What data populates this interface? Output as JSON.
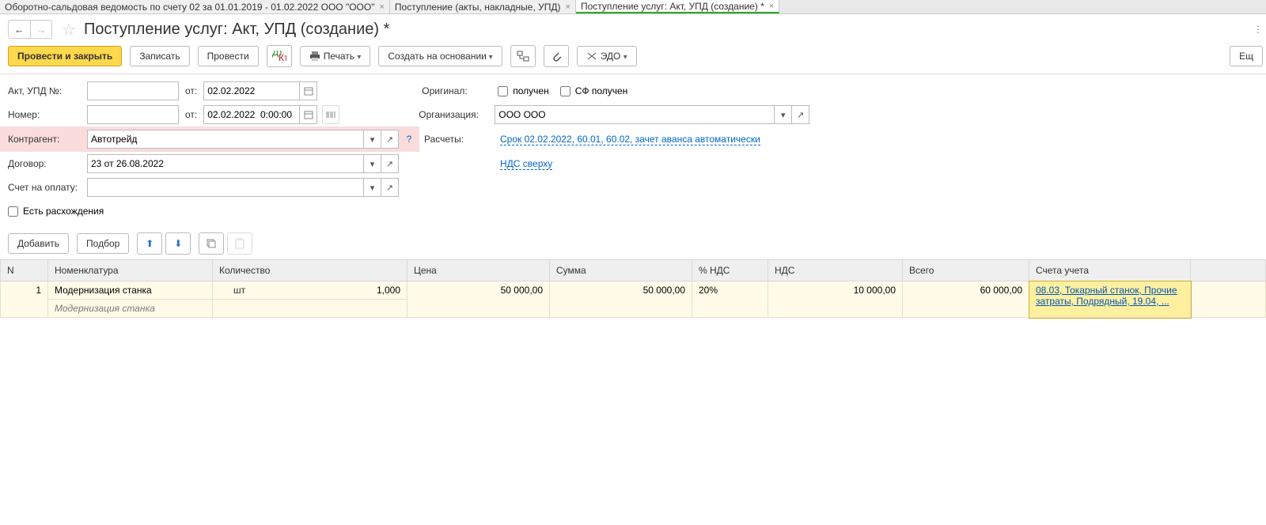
{
  "tabs": [
    {
      "label": "Оборотно-сальдовая ведомость по счету 02 за 01.01.2019 - 01.02.2022 ООО \"ООО\"",
      "active": false
    },
    {
      "label": "Поступление (акты, накладные, УПД)",
      "active": false
    },
    {
      "label": "Поступление услуг: Акт, УПД (создание) *",
      "active": true
    }
  ],
  "page_title": "Поступление услуг: Акт, УПД (создание) *",
  "toolbar": {
    "post_close": "Провести и закрыть",
    "write": "Записать",
    "post": "Провести",
    "print": "Печать",
    "create_based": "Создать на основании",
    "edo": "ЭДО",
    "more": "Ещ"
  },
  "form": {
    "act_no_label": "Акт, УПД №:",
    "act_no_value": "",
    "from_label": "от:",
    "act_date": "02.02.2022",
    "number_label": "Номер:",
    "number_value": "",
    "number_date": "02.02.2022  0:00:00",
    "original_label": "Оригинал:",
    "received_label": "получен",
    "sf_received_label": "СФ получен",
    "org_label": "Организация:",
    "org_value": "ООО ООО",
    "kontr_label": "Контрагент:",
    "kontr_value": "Автотрейд",
    "raschet_label": "Расчеты:",
    "raschet_link": "Срок 02.02.2022, 60.01, 60.02, зачет аванса автоматически",
    "dogovor_label": "Договор:",
    "dogovor_value": "23 от 26.08.2022",
    "nds_link": "НДС сверху",
    "schet_label": "Счет на оплату:",
    "schet_value": "",
    "divergence_label": "Есть расхождения"
  },
  "table_toolbar": {
    "add": "Добавить",
    "select_btn": "Подбор"
  },
  "table": {
    "headers": {
      "n": "N",
      "nom": "Номенклатура",
      "qty": "Количество",
      "price": "Цена",
      "sum": "Сумма",
      "vat_pct": "% НДС",
      "vat": "НДС",
      "total": "Всего",
      "accounts": "Счета учета"
    },
    "rows": [
      {
        "n": "1",
        "nom": "Модернизация станка",
        "nom_sub": "Модернизация станка",
        "qty": "1,000",
        "unit": "шт",
        "price": "50 000,00",
        "sum": "50 000,00",
        "vat_pct": "20%",
        "vat": "10 000,00",
        "total": "60 000,00",
        "accounts": "08.03, Токарный станок, Прочие затраты, Подрядный, 19.04, ..."
      }
    ]
  }
}
